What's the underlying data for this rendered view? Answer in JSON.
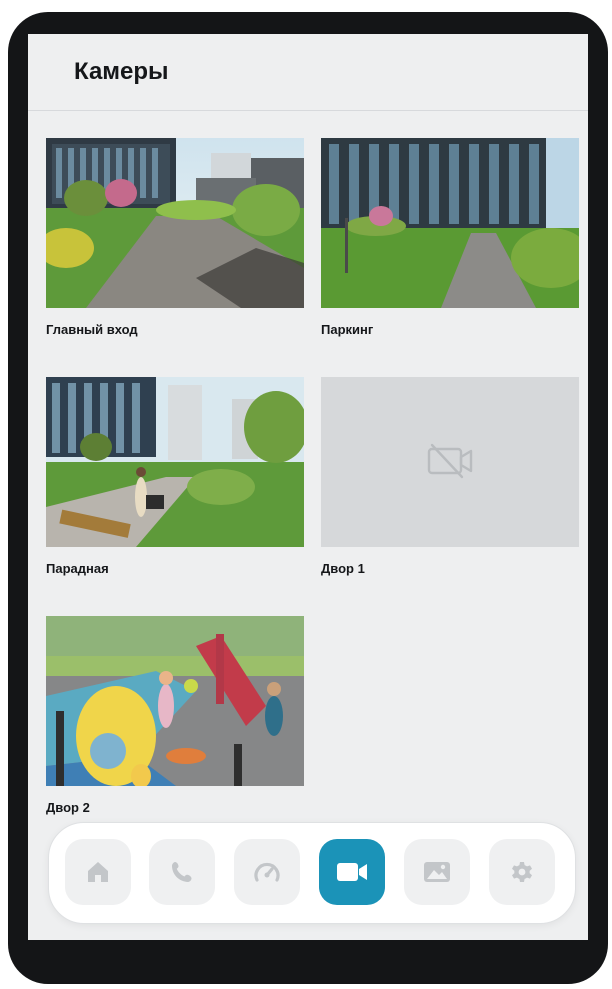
{
  "header": {
    "title": "Камеры"
  },
  "cameras": [
    {
      "label": "Главный вход",
      "status": "online"
    },
    {
      "label": "Паркинг",
      "status": "online"
    },
    {
      "label": "Парадная",
      "status": "online"
    },
    {
      "label": "Двор 1",
      "status": "offline"
    },
    {
      "label": "Двор 2",
      "status": "online"
    }
  ],
  "nav": {
    "items": [
      {
        "icon": "home-icon"
      },
      {
        "icon": "phone-icon"
      },
      {
        "icon": "gauge-icon"
      },
      {
        "icon": "video-camera-icon",
        "active": true
      },
      {
        "icon": "image-icon"
      },
      {
        "icon": "gear-icon"
      }
    ]
  },
  "colors": {
    "accent": "#1b93b8",
    "screen_bg": "#eeeff0",
    "bezel": "#141517",
    "placeholder": "#d6d8da"
  }
}
